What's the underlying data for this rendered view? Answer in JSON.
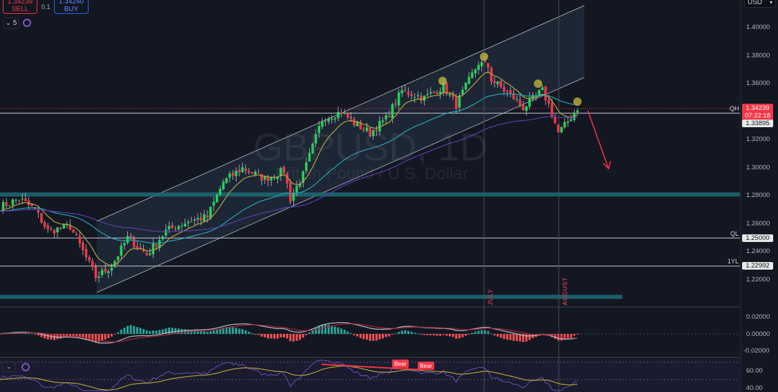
{
  "toolbar": {
    "sell_price": "1.34239",
    "sell_label": "SELL",
    "spread": "0.1",
    "buy_price": "1.34240",
    "buy_label": "BUY",
    "interval": "5",
    "currency": "USD"
  },
  "watermark": {
    "symbol": "GBPUSD, 1D",
    "description": "British Pound / U.S. Dollar"
  },
  "price_axis": [
    "1.40000",
    "1.38000",
    "1.36000",
    "1.32000",
    "1.30000",
    "1.28000",
    "1.26000",
    "1.24000",
    "1.22000"
  ],
  "price_tags": {
    "current_price": "1.34239",
    "countdown": "07:22:18",
    "qh_label": "QH",
    "qh_value": "1.33895",
    "ql_label": "QL",
    "ql_value": "1.25000",
    "yl_label": "1YL",
    "yl_value": "1.22992"
  },
  "months": {
    "july": "JULY",
    "august": "AUGUST"
  },
  "macd_axis": [
    "0.02000",
    "0.00000",
    "-0.02000"
  ],
  "rsi_axis": [
    "60.00",
    "40.00"
  ],
  "rsi_signals": [
    "Bear",
    "Bear"
  ],
  "colors": {
    "up": "#22d35a",
    "down": "#f23645",
    "ma_fast": "#b5a642",
    "ma_mid": "#26a6b8",
    "ma_slow": "#5b3fb0",
    "zone": "#1e6b73"
  },
  "chart_data": {
    "type": "candlestick",
    "symbol": "GBPUSD",
    "timeframe": "1D",
    "ylim": [
      1.2,
      1.41
    ],
    "price_path": [
      [
        0,
        1.272
      ],
      [
        6,
        1.278
      ],
      [
        11,
        1.27
      ],
      [
        15,
        1.255
      ],
      [
        22,
        1.258
      ],
      [
        25,
        1.245
      ],
      [
        30,
        1.222
      ],
      [
        35,
        1.23
      ],
      [
        40,
        1.25
      ],
      [
        46,
        1.238
      ],
      [
        52,
        1.255
      ],
      [
        59,
        1.262
      ],
      [
        65,
        1.265
      ],
      [
        70,
        1.29
      ],
      [
        76,
        1.3
      ],
      [
        83,
        1.292
      ],
      [
        89,
        1.298
      ],
      [
        91,
        1.278
      ],
      [
        95,
        1.295
      ],
      [
        101,
        1.335
      ],
      [
        107,
        1.34
      ],
      [
        111,
        1.332
      ],
      [
        116,
        1.325
      ],
      [
        121,
        1.335
      ],
      [
        126,
        1.355
      ],
      [
        133,
        1.35
      ],
      [
        139,
        1.358
      ],
      [
        143,
        1.345
      ],
      [
        150,
        1.375
      ],
      [
        153,
        1.372
      ],
      [
        154,
        1.363
      ],
      [
        161,
        1.35
      ],
      [
        164,
        1.343
      ],
      [
        170,
        1.355
      ],
      [
        172,
        1.345
      ],
      [
        175,
        1.325
      ],
      [
        177,
        1.33
      ],
      [
        181,
        1.343
      ]
    ],
    "levels": {
      "QH": 1.33895,
      "QL": 1.25,
      "1YL": 1.22992,
      "current": 1.34239
    },
    "zones": [
      1.281,
      1.208
    ]
  }
}
